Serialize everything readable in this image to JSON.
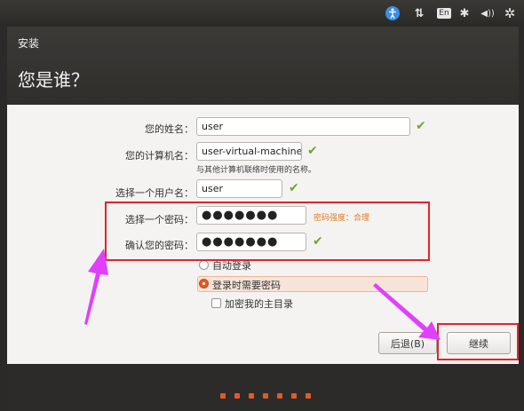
{
  "tray": {
    "accessibility_label": "",
    "network_label": "⇅",
    "keyboard_layout": "En",
    "bluetooth_label": "✱",
    "volume_label": "◀))",
    "settings_label": "✲"
  },
  "window": {
    "title": "安装",
    "heading": "您是谁？"
  },
  "form": {
    "name_label": "您的姓名：",
    "name_value": "user",
    "computer_label": "您的计算机名：",
    "computer_value": "user-virtual-machine",
    "computer_hint": "与其他计算机联络时使用的名称。",
    "username_label": "选择一个用户名：",
    "username_value": "user",
    "password_label": "选择一个密码：",
    "password_value": "●●●●●●●",
    "password_strength": "密码强度：合理",
    "confirm_label": "确认您的密码：",
    "confirm_value": "●●●●●●●",
    "check_mark": "✔"
  },
  "login": {
    "auto_login_label": "自动登录",
    "require_password_label": "登录时需要密码",
    "encrypt_home_label": "加密我的主目录",
    "selected": "require_password",
    "encrypt_home_checked": false
  },
  "buttons": {
    "back_label": "后退(B)",
    "continue_label": "继续"
  },
  "progress": {
    "dots_total": 7
  },
  "colors": {
    "accent": "#e35a26",
    "annotation_red": "#e1242b",
    "annotation_arrow": "#e040fb",
    "check_green": "#6ea632",
    "strength_orange": "#e07a1c"
  }
}
